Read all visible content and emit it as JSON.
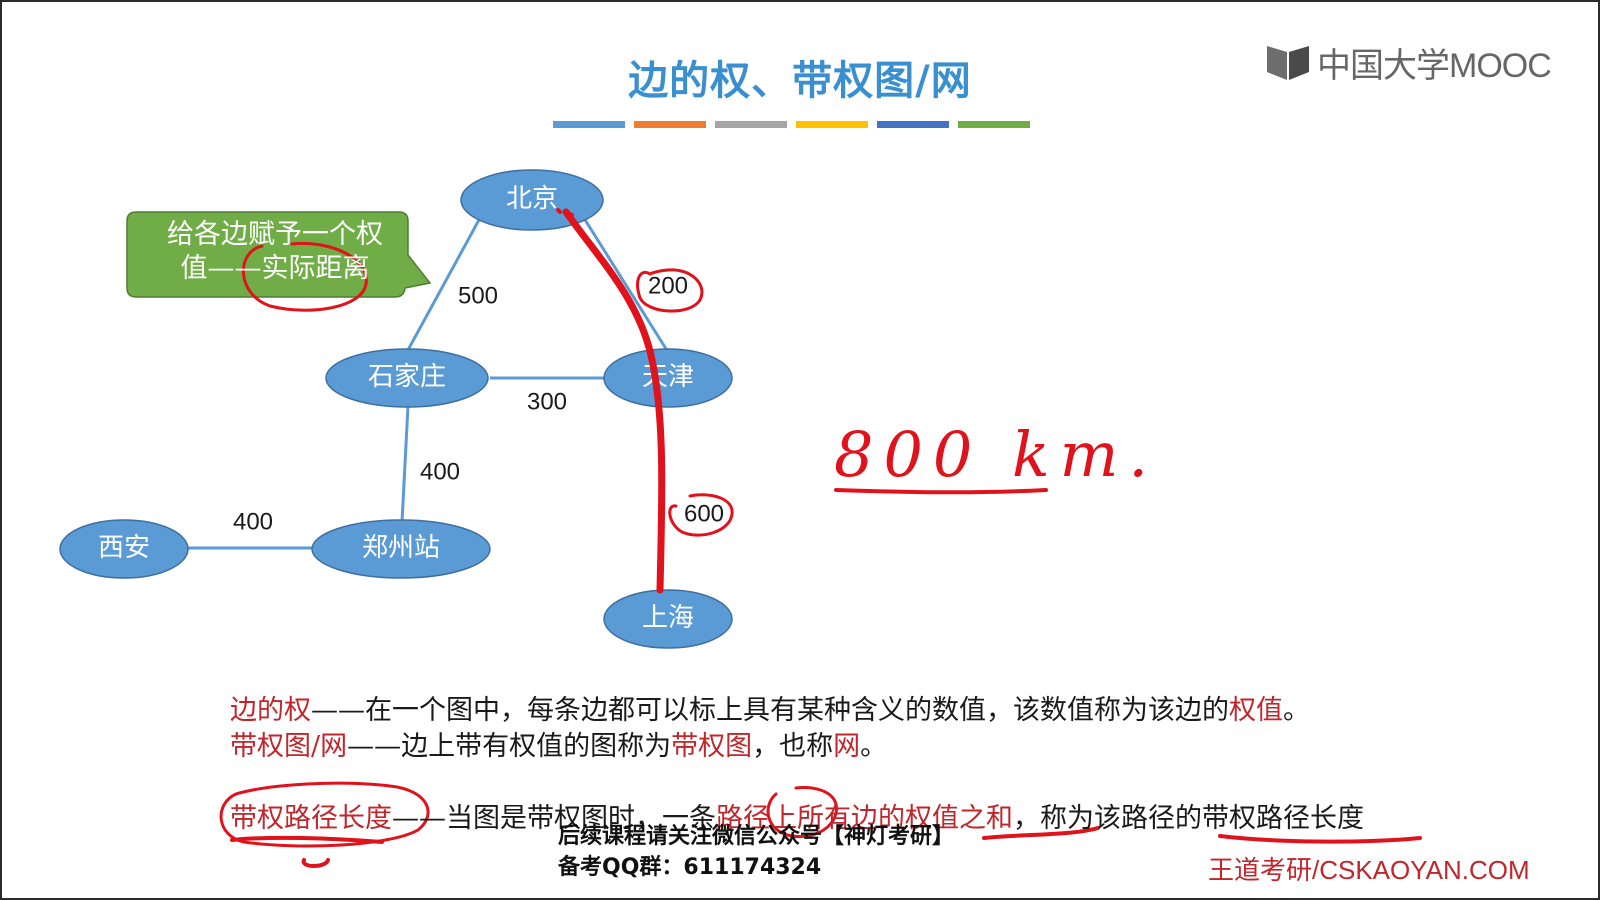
{
  "slide": {
    "title": "边的权、带权图/网",
    "title_bar_colors": [
      "#5b9bd5",
      "#ed7d31",
      "#a5a5a5",
      "#ffc000",
      "#4472c4",
      "#70ad47"
    ]
  },
  "logo": {
    "text": "中国大学MOOC",
    "icon": "book-icon"
  },
  "callout": {
    "line1": "给各边赋予一个权",
    "line2": "值——实际距离",
    "color": "#70ad47"
  },
  "graph": {
    "node_color": "#5b9bd5",
    "nodes": {
      "beijing": "北京",
      "tianjin": "天津",
      "shijiazhuang": "石家庄",
      "zhengzhou": "郑州站",
      "xian": "西安",
      "shanghai": "上海"
    },
    "edges": {
      "beijing_shijiazhuang": "500",
      "beijing_tianjin": "200",
      "shijiazhuang_tianjin": "300",
      "shijiazhuang_zhengzhou": "400",
      "xian_zhengzhou": "400",
      "tianjin_shanghai": "600"
    }
  },
  "annotation": {
    "handwritten": "800 km.",
    "ink_color": "#e0121b"
  },
  "definitions": {
    "line1": {
      "term": "边的权",
      "dash": "——",
      "text": "在一个图中，每条边都可以标上具有某种含义的数值，该数值称为该边的",
      "term2": "权值",
      "end": "。"
    },
    "line2": {
      "term": "带权图/网",
      "dash": "——",
      "text1": "边上带有权值的图称为",
      "term2": "带权图",
      "text2": "，也称",
      "term3": "网",
      "end": "。"
    },
    "line3": {
      "term": "带权路径长度",
      "dash": "——",
      "text1": "当图是带权图时，一条",
      "term2": "路径上所有边的权值之和",
      "text2": "，称为该路径的带权路径长度"
    }
  },
  "promo": {
    "line1": "后续课程请关注微信公众号【神灯考研】",
    "line2": "备考QQ群：611174324"
  },
  "footer": {
    "text": "王道考研/CSKAOYAN.COM"
  }
}
